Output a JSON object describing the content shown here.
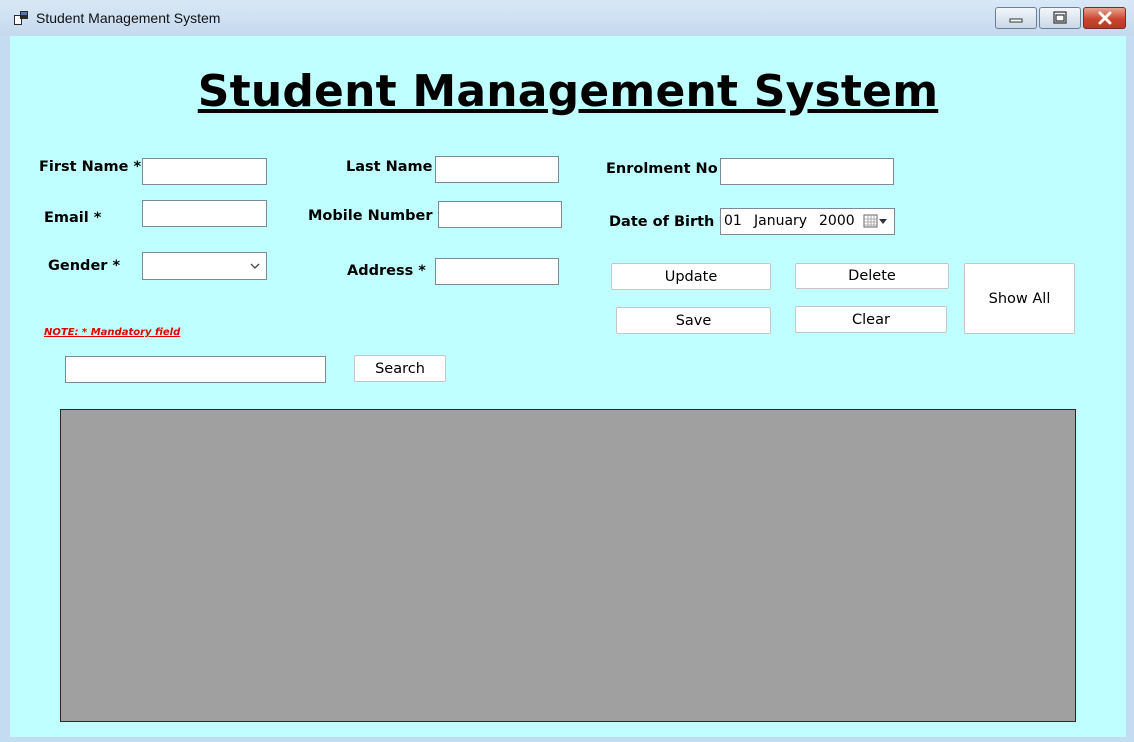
{
  "window": {
    "title": "Student Management System",
    "icon": "app-icon",
    "controls": [
      "minimize-icon",
      "maximize-icon",
      "close-icon"
    ]
  },
  "form": {
    "heading": "Student Management System",
    "first_name": {
      "label": "First Name *",
      "value": ""
    },
    "last_name": {
      "label": "Last Name",
      "value": ""
    },
    "enrolment_no": {
      "label": "Enrolment No *",
      "value": ""
    },
    "email": {
      "label": "Email *",
      "value": ""
    },
    "mobile_number": {
      "label": "Mobile Number *",
      "value": ""
    },
    "date_of_birth": {
      "label": "Date of Birth *",
      "day": "01",
      "month": "January",
      "year": "2000"
    },
    "gender": {
      "label": "Gender *",
      "value": ""
    },
    "address": {
      "label": "Address *",
      "value": ""
    },
    "note": "NOTE: * Mandatory field"
  },
  "actions": {
    "update": "Update",
    "delete": "Delete",
    "show_all": "Show All",
    "save": "Save",
    "clear": "Clear"
  },
  "search": {
    "value": "",
    "button_label": "Search"
  },
  "colors": {
    "background": "#c0ffff",
    "grid": "#a0a0a0",
    "note": "#e00000"
  }
}
